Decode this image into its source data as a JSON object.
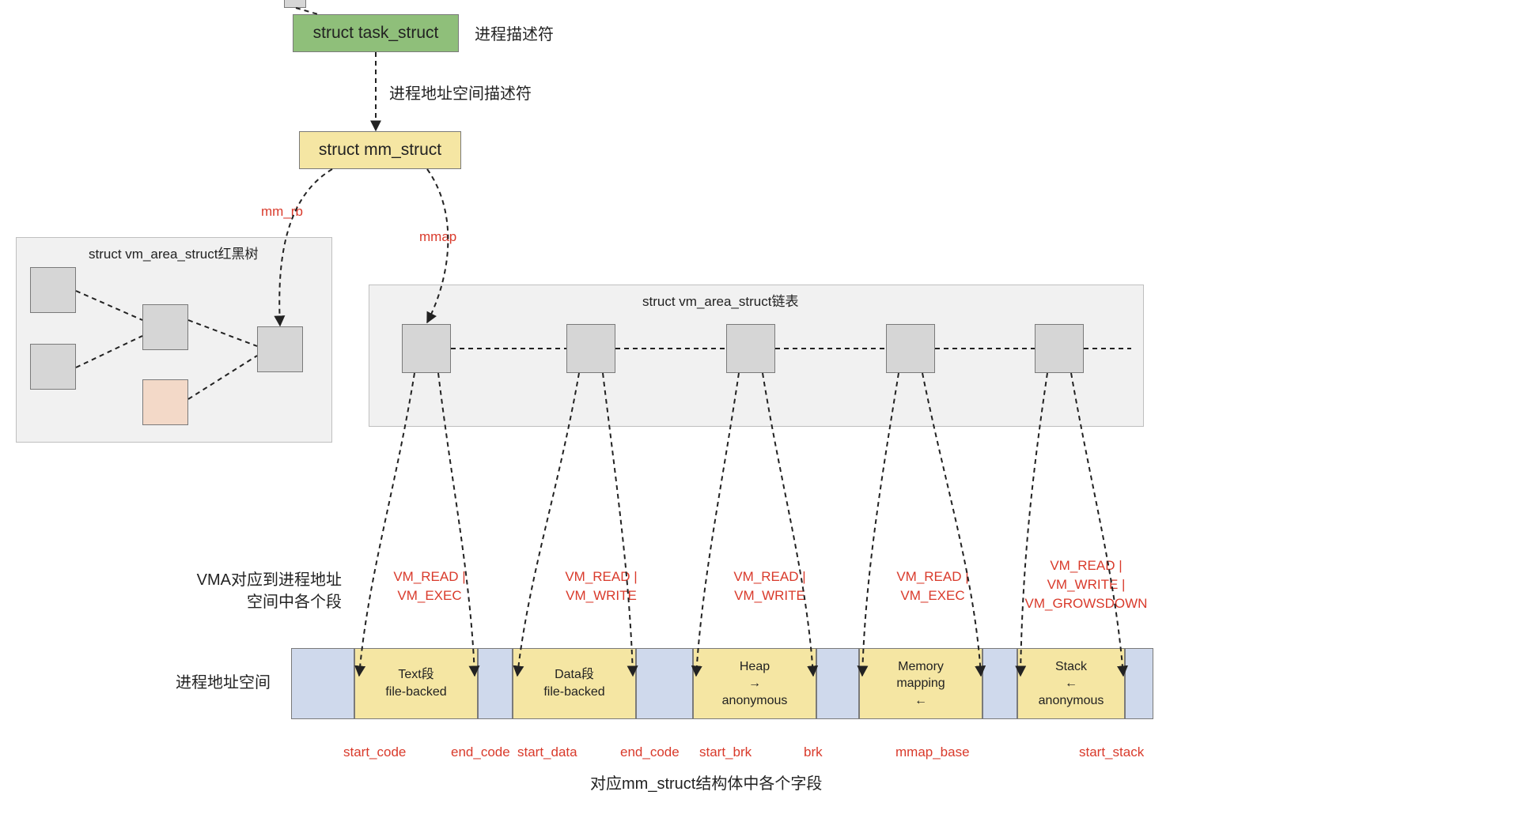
{
  "colors": {
    "green": "#8fbf7a",
    "yellow": "#f5e6a3",
    "gray": "#d6d6d6",
    "peach": "#f3d9c8",
    "blue": "#cfd9ec",
    "region": "#f1f1f1",
    "red": "#d93a2b"
  },
  "taskStruct": {
    "label": "struct task_struct",
    "desc": "进程描述符"
  },
  "mmStruct": {
    "label": "struct mm_struct",
    "arrowLabel": "进程地址空间描述符",
    "mm_rb": "mm_rb",
    "mmap": "mmap"
  },
  "rbTree": {
    "title": "struct vm_area_struct红黑树"
  },
  "vmaList": {
    "title": "struct vm_area_struct链表"
  },
  "vmaDescLabel": "VMA对应到进程地址\n空间中各个段",
  "addrSpaceLabel": "进程地址空间",
  "footer": "对应mm_struct结构体中各个字段",
  "flags": {
    "0": "VM_READ |\nVM_EXEC",
    "1": "VM_READ |\nVM_WRITE",
    "2": "VM_READ |\nVM_WRITE",
    "3": "VM_READ |\nVM_EXEC",
    "4": "VM_READ |\nVM_WRITE |\nVM_GROWSDOWN"
  },
  "segments": {
    "0": {
      "title": "Text段",
      "sub": "file-backed",
      "arrow": ""
    },
    "1": {
      "title": "Data段",
      "sub": "file-backed",
      "arrow": ""
    },
    "2": {
      "title": "Heap",
      "sub": "anonymous",
      "arrow": "→"
    },
    "3": {
      "title": "Memory\nmapping",
      "sub": "",
      "arrow": "←"
    },
    "4": {
      "title": "Stack",
      "sub": "anonymous",
      "arrow": "←"
    }
  },
  "boundaries": {
    "b0": "start_code",
    "b1": "end_code",
    "b2": "start_data",
    "b3": "end_code",
    "b4": "start_brk",
    "b5": "brk",
    "b6": "mmap_base",
    "b7": "start_stack"
  }
}
